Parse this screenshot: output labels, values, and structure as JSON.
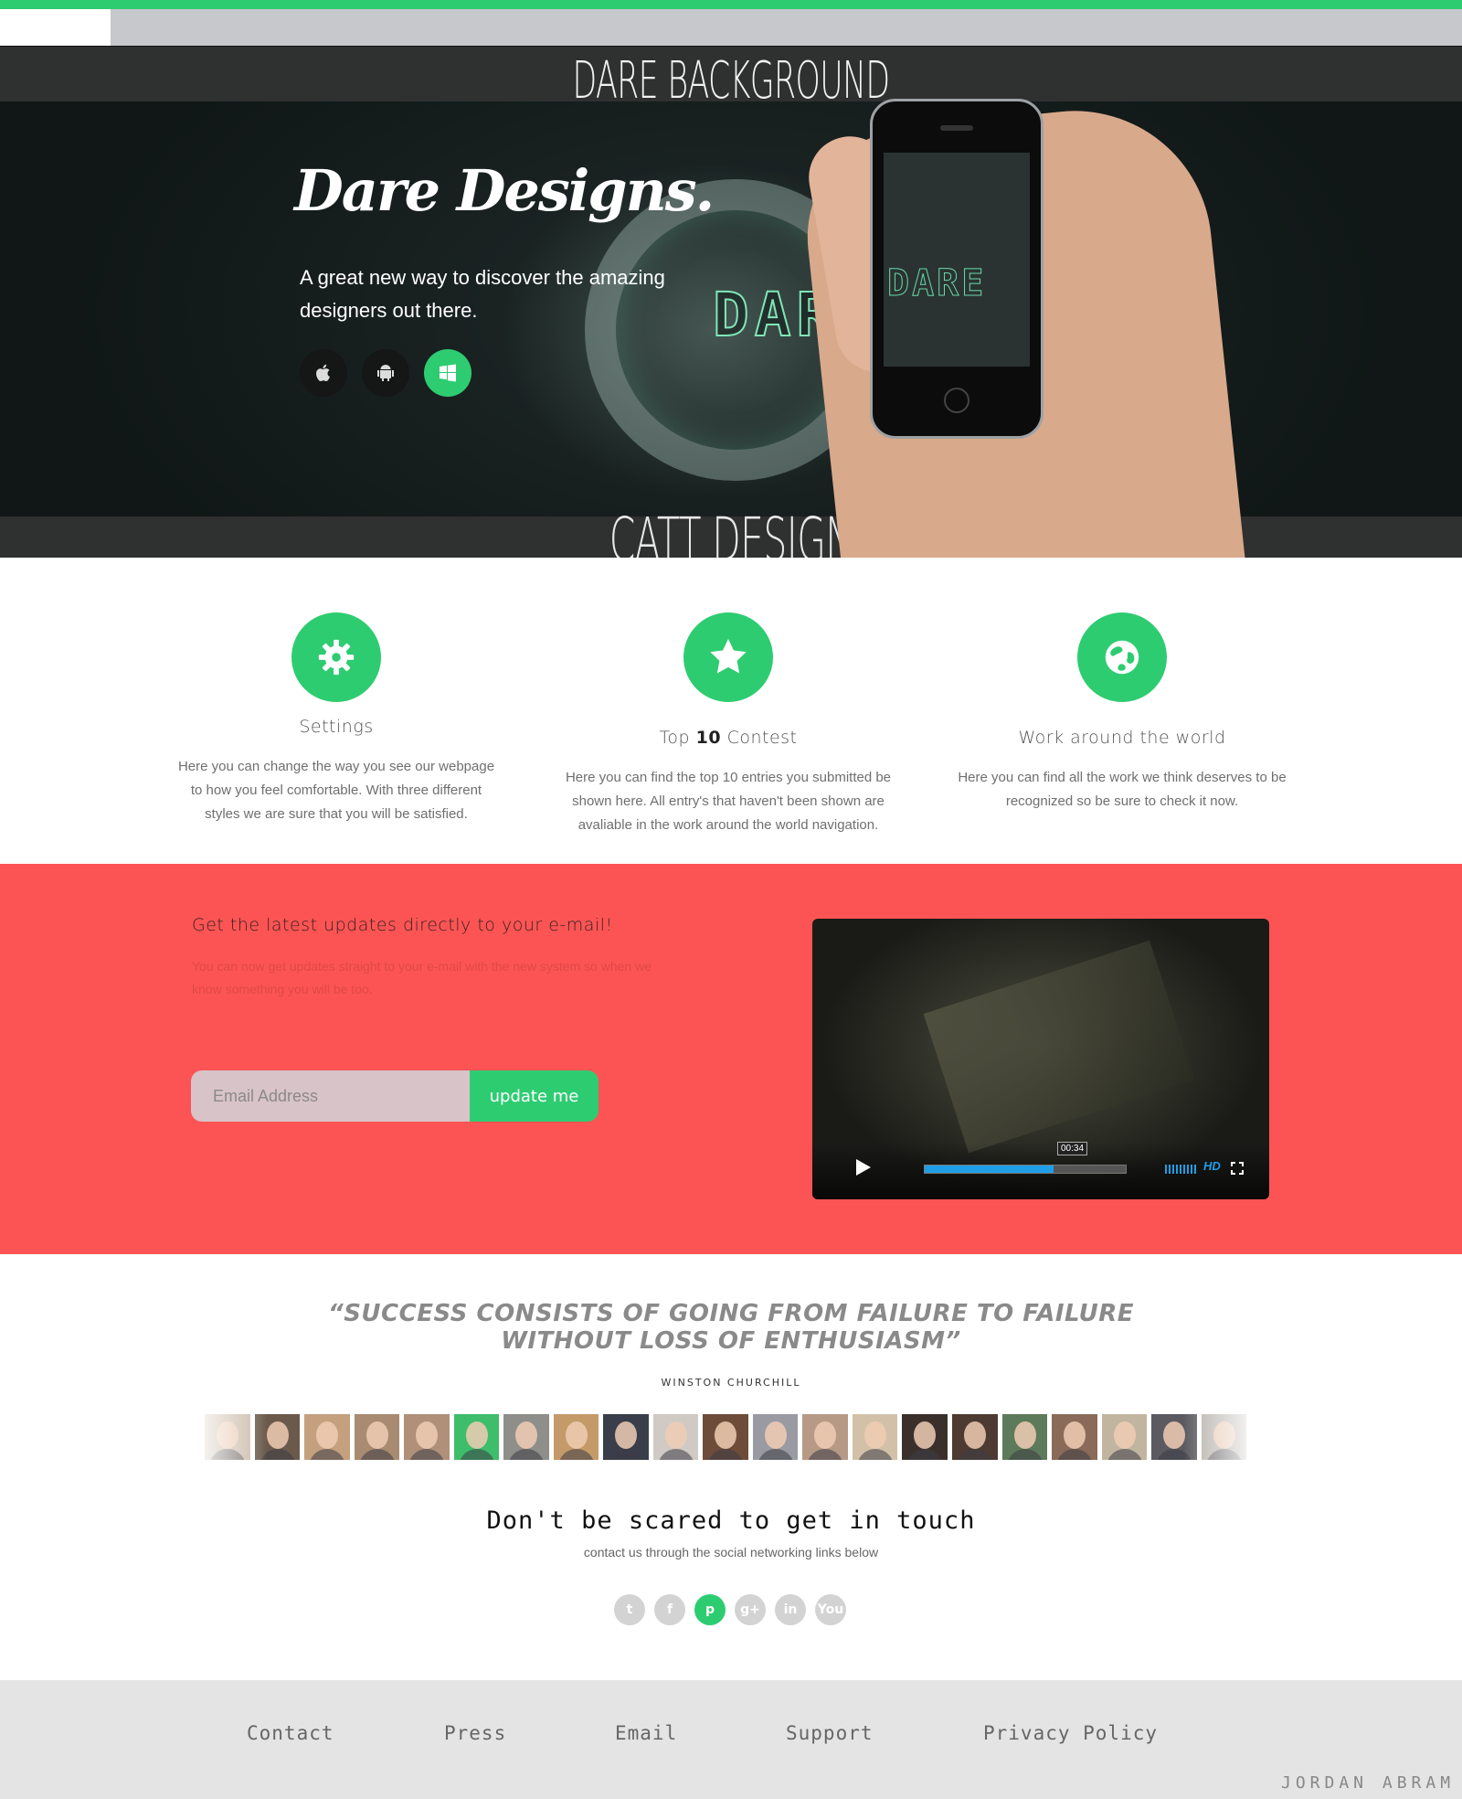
{
  "hero": {
    "band_top_title": "DARE BACKGROUND",
    "band_bottom_title": "CATT DESIGN",
    "logo_text": "DARE",
    "brand": "Dare Designs.",
    "tagline": "A great new way to discover the amazing designers out there.",
    "store_buttons": [
      {
        "icon": "apple-icon",
        "active": false
      },
      {
        "icon": "android-icon",
        "active": false
      },
      {
        "icon": "windows-icon",
        "active": true
      }
    ]
  },
  "features": [
    {
      "icon": "gear-icon",
      "title": "Settings",
      "text": "Here you can change the way you see our webpage to how you feel comfortable. With three different styles we are sure that you will be satisfied."
    },
    {
      "icon": "star-icon",
      "title_pre": "Top ",
      "title_num": "10",
      "title_post": " Contest",
      "text": "Here you can find the top 10 entries you submitted be shown here. All entry's that haven't been shown are avaliable in the work around the world navigation."
    },
    {
      "icon": "globe-icon",
      "title": "Work around the world",
      "text": "Here you can find all the work we think deserves to be recognized so be sure to check it now."
    }
  ],
  "newsletter": {
    "title": "Get the latest updates directly to your e-mail!",
    "text": "You can now get updates straight to your e-mail with the new system so when we know something you will be too.",
    "email_placeholder": "Email Address",
    "email_value": "",
    "button_label": "update me"
  },
  "video": {
    "time": "00:34",
    "progress": 0.64,
    "hd_label": "HD"
  },
  "quote": {
    "line1": "“SUCCESS CONSISTS OF GOING FROM FAILURE TO FAILURE",
    "line2": "WITHOUT LOSS OF ENTHUSIASM”",
    "author": "WINSTON CHURCHILL"
  },
  "faces": {
    "count": 21,
    "colors": [
      "#c9b8a6",
      "#6b5a4c",
      "#c4a07e",
      "#a88b70",
      "#b09079",
      "#3ebd6a",
      "#8e8e8a",
      "#c49a68",
      "#3a3d4a",
      "#cfcac4",
      "#6e4c3a",
      "#9a9aa2",
      "#b79a86",
      "#d2c1a8",
      "#3b2f2c",
      "#4d3b32",
      "#5d7a5a",
      "#8a6a58",
      "#c2b5a0",
      "#5a5a60",
      "#b4b0aa"
    ]
  },
  "contact": {
    "title": "Don't be scared to get in touch",
    "subtitle": "contact us through the  social networking links below",
    "social": [
      {
        "icon": "twitter-icon",
        "glyph": "t",
        "active": false
      },
      {
        "icon": "facebook-icon",
        "glyph": "f",
        "active": false
      },
      {
        "icon": "pinterest-icon",
        "glyph": "p",
        "active": true
      },
      {
        "icon": "google-plus-icon",
        "glyph": "g+",
        "active": false
      },
      {
        "icon": "linkedin-icon",
        "glyph": "in",
        "active": false
      },
      {
        "icon": "youtube-icon",
        "glyph": "You",
        "active": false
      }
    ]
  },
  "footer": {
    "links": [
      "Contact",
      "Press",
      "Email",
      "Support",
      "Privacy Policy"
    ],
    "credit": "JORDAN ABRAM"
  },
  "colors": {
    "accent": "#2ecc71",
    "newsletter_bg": "#fc5454",
    "footer_bg": "#e4e4e4"
  }
}
